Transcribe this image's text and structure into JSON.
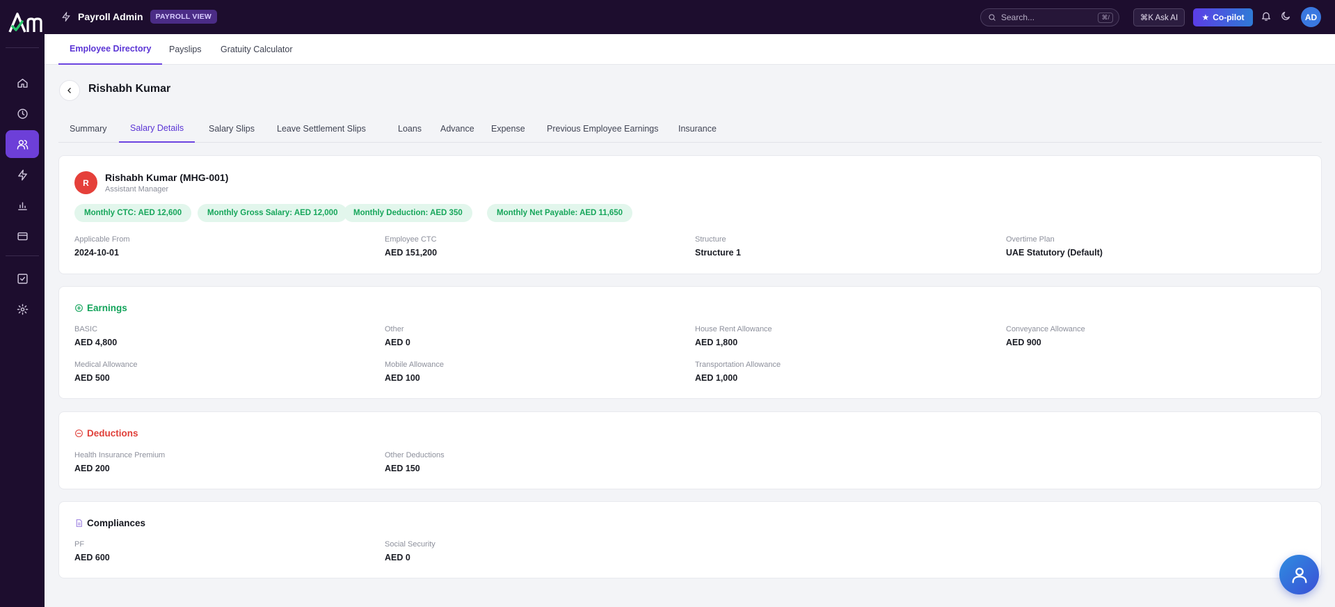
{
  "topbar": {
    "app_name": "Payroll Admin",
    "view_badge": "PAYROLL VIEW",
    "search_placeholder": "Search...",
    "search_shortcut": "⌘/",
    "ask_ai_label": "⌘K Ask AI",
    "copilot_label": "Co-pilot",
    "user_initials": "AD"
  },
  "sidebar": {
    "icons": [
      "home-icon",
      "clock-icon",
      "users-icon",
      "bolt-icon",
      "bar-chart-icon",
      "card-icon",
      "checkbox-icon",
      "gear-icon"
    ],
    "active": "users-icon"
  },
  "module_tabs": [
    {
      "label": "Employee Directory",
      "active": true
    },
    {
      "label": "Payslips",
      "active": false
    },
    {
      "label": "Gratuity Calculator",
      "active": false
    }
  ],
  "employee": {
    "page_title": "Rishabh Kumar",
    "display_name": "Rishabh Kumar (MHG-001)",
    "role": "Assistant Manager",
    "avatar_initial": "R"
  },
  "sub_tabs": [
    {
      "label": "Summary",
      "active": false
    },
    {
      "label": "Salary Details",
      "active": true
    },
    {
      "label": "Salary Slips",
      "active": false
    },
    {
      "label": "Leave Settlement Slips",
      "active": false
    },
    {
      "label": "Loans",
      "active": false
    },
    {
      "label": "Advance",
      "active": false
    },
    {
      "label": "Expense",
      "active": false
    },
    {
      "label": "Previous Employee Earnings",
      "active": false
    },
    {
      "label": "Insurance",
      "active": false
    }
  ],
  "summary_pills": [
    "Monthly CTC: AED 12,600",
    "Monthly Gross Salary: AED 12,000",
    "Monthly Deduction: AED 350",
    "Monthly Net Payable: AED 11,650"
  ],
  "overview_fields": [
    {
      "label": "Applicable From",
      "value": "2024-10-01"
    },
    {
      "label": "Employee CTC",
      "value": "AED 151,200"
    },
    {
      "label": "Structure",
      "value": "Structure 1"
    },
    {
      "label": "Overtime Plan",
      "value": "UAE Statutory (Default)"
    }
  ],
  "earnings": {
    "title": "Earnings",
    "items": [
      {
        "label": "BASIC",
        "value": "AED 4,800"
      },
      {
        "label": "Other",
        "value": "AED 0"
      },
      {
        "label": "House Rent Allowance",
        "value": "AED 1,800"
      },
      {
        "label": "Conveyance Allowance",
        "value": "AED 900"
      },
      {
        "label": "Medical Allowance",
        "value": "AED 500"
      },
      {
        "label": "Mobile Allowance",
        "value": "AED 100"
      },
      {
        "label": "Transportation Allowance",
        "value": "AED 1,000"
      }
    ]
  },
  "deductions": {
    "title": "Deductions",
    "items": [
      {
        "label": "Health Insurance Premium",
        "value": "AED 200"
      },
      {
        "label": "Other Deductions",
        "value": "AED 150"
      }
    ]
  },
  "compliances": {
    "title": "Compliances",
    "items": [
      {
        "label": "PF",
        "value": "AED 600"
      },
      {
        "label": "Social Security",
        "value": "AED 0"
      }
    ]
  },
  "colors": {
    "sidebar_bg": "#1d0d2e",
    "accent": "#6c45e0",
    "earnings": "#12a35a",
    "deductions": "#e0403a",
    "pill_bg": "#e2f6ec"
  }
}
